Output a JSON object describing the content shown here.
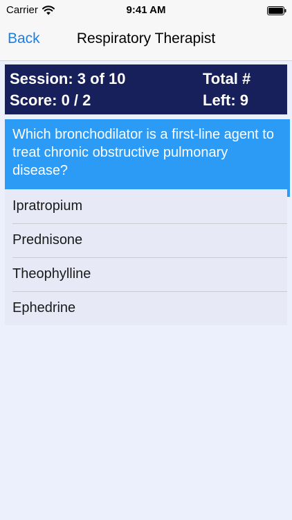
{
  "status_bar": {
    "carrier": "Carrier",
    "time": "9:41 AM",
    "wifi_icon": "wifi-icon",
    "battery_icon": "battery-icon"
  },
  "nav": {
    "back_label": "Back",
    "title": "Respiratory Therapist"
  },
  "stats": {
    "session": "Session: 3 of 10",
    "score": "Score: 0 / 2",
    "total_label": "Total #",
    "left": "Left: 9"
  },
  "question": {
    "text": "Which bronchodilator is a first-line agent to treat chronic obstructive pulmonary disease?"
  },
  "answers": [
    {
      "label": "Ipratropium"
    },
    {
      "label": "Prednisone"
    },
    {
      "label": "Theophylline"
    },
    {
      "label": "Ephedrine"
    }
  ],
  "colors": {
    "accent": "#1a7fe6",
    "stats_background": "#17205a",
    "question_background": "#2b9bf5",
    "answer_background": "#e7e9f6",
    "page_background": "#ecf0fd"
  }
}
